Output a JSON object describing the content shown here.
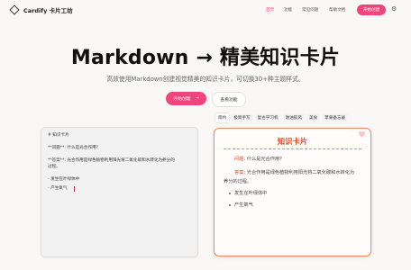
{
  "brand": {
    "name": "Cardify 卡片工坊"
  },
  "nav": {
    "items": [
      "首页",
      "功能",
      "常见问题",
      "帮助文档"
    ],
    "cta": "开始创建"
  },
  "hero": {
    "title": "Markdown → 精美知识卡片",
    "subtitle": "高效使用Markdown创建视觉精美的知识卡片，可切换30+种主题样式。",
    "primary_button": "开始创建",
    "primary_arrow": "→",
    "secondary_button": "查看功能"
  },
  "editor": {
    "lines": [
      "# 知识卡片",
      "**问题**: 什么是光合作用？",
      "**答案**: 光合作用是绿色植物利用阳光将二氧化碳和水转化为养分的",
      "过程。",
      "- 发生在叶绿体中",
      "- 产生氧气"
    ]
  },
  "themes": {
    "tabs": [
      "简约",
      "极简手写",
      "复古学习机",
      "防油胶风",
      "美食",
      "苹果备忘录"
    ],
    "active_index": 0
  },
  "card": {
    "title": "知识卡片",
    "question_label": "问题",
    "question_text": ": 什么是光合作用？",
    "answer_label": "答案",
    "answer_text_1": ": 光合作用是绿色植物利用阳光将二氧化碳和水转化为",
    "answer_text_2": "养分的过程。",
    "bullets": [
      "发生在叶绿体中",
      "产生氧气"
    ]
  },
  "colors": {
    "accent": "#f0457c",
    "card_title": "#e04a2f",
    "card_border": "#ef8b6a"
  },
  "icons": {
    "logo": "diamond-logo-icon",
    "settings": "gear-icon",
    "arrow": "arrow-right-icon",
    "card_decoration": "heart-icon"
  }
}
